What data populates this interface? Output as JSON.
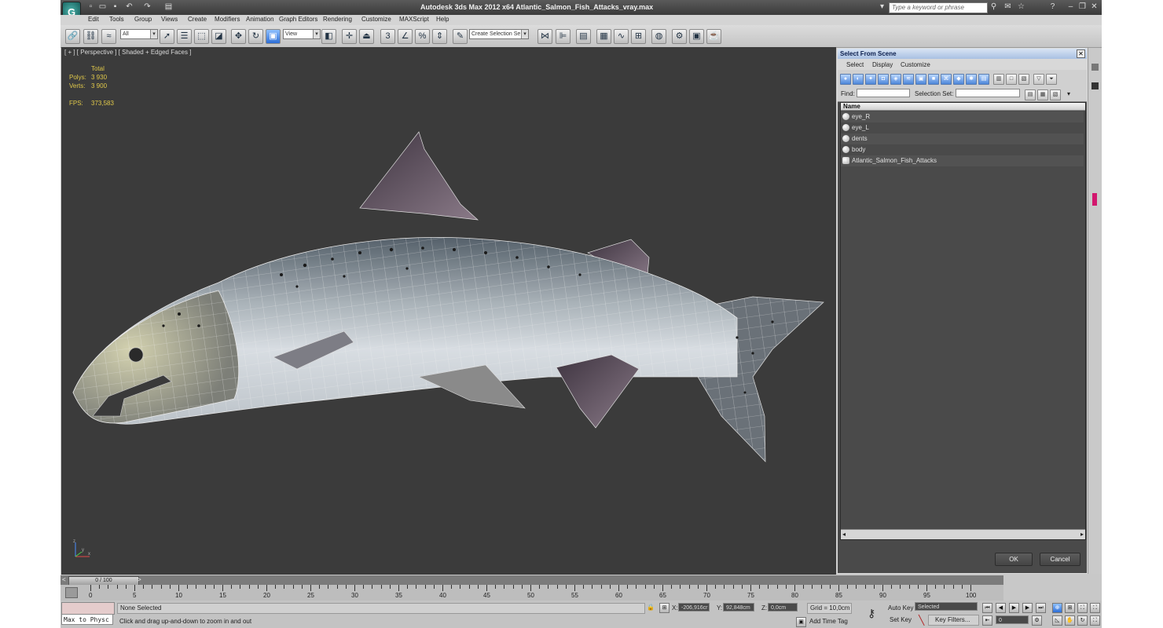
{
  "window": {
    "title": "Autodesk 3ds Max  2012 x64     Atlantic_Salmon_Fish_Attacks_vray.max",
    "logo": "3ds-max-logo",
    "search_placeholder": "Type a keyword or phrase"
  },
  "menu": [
    "Edit",
    "Tools",
    "Group",
    "Views",
    "Create",
    "Modifiers",
    "Animation",
    "Graph Editors",
    "Rendering",
    "Customize",
    "MAXScript",
    "Help"
  ],
  "toolbar": {
    "selection_filter": "All",
    "ref_coord": "View",
    "selection_set_placeholder": "Create Selection Se"
  },
  "viewport": {
    "label": "[ + ] [ Perspective ] [ Shaded + Edged Faces ]",
    "stats": {
      "header": "Total",
      "polys_label": "Polys:",
      "polys_value": "3 930",
      "verts_label": "Verts:",
      "verts_value": "3 900",
      "fps_label": "FPS:",
      "fps_value": "373,583"
    },
    "axis": {
      "z": "z",
      "x": "x",
      "y": "y"
    }
  },
  "dialog": {
    "title": "Select From Scene",
    "menu": [
      "Select",
      "Display",
      "Customize"
    ],
    "find_label": "Find:",
    "find_value": "",
    "selection_set_label": "Selection Set:",
    "selection_set_value": "",
    "column_header": "Name",
    "items": [
      "eye_R",
      "eye_L",
      "dents",
      "body",
      "Atlantic_Salmon_Fish_Attacks"
    ],
    "ok_label": "OK",
    "cancel_label": "Cancel"
  },
  "timeline": {
    "frame_indicator": "0 / 100",
    "prev_arrow": "<",
    "next_arrow": ">",
    "ticks": [
      "0",
      "5",
      "10",
      "15",
      "20",
      "25",
      "30",
      "35",
      "40",
      "45",
      "50",
      "55",
      "60",
      "65",
      "70",
      "75",
      "80",
      "85",
      "90",
      "95",
      "100"
    ]
  },
  "status": {
    "maxscript_listener": "Max to Physc",
    "selection_status": "None Selected",
    "prompt": "Click and drag up-and-down to zoom in and out",
    "x_label": "X:",
    "x_value": "-206,916cr",
    "y_label": "Y:",
    "y_value": "92,848cm",
    "z_label": "Z:",
    "z_value": "0,0cm",
    "grid": "Grid = 10,0cm",
    "add_time_tag": "Add Time Tag",
    "auto_key": "Auto Key",
    "set_key": "Set Key",
    "key_mode": "Selected",
    "key_filters": "Key Filters...",
    "current_frame": "0"
  },
  "colors": {
    "viewport_bg": "#3b3b3b",
    "dialog_bg": "#4a4a4a",
    "stats_text": "#e0c84a",
    "accent_blue": "#2d6ed6"
  }
}
